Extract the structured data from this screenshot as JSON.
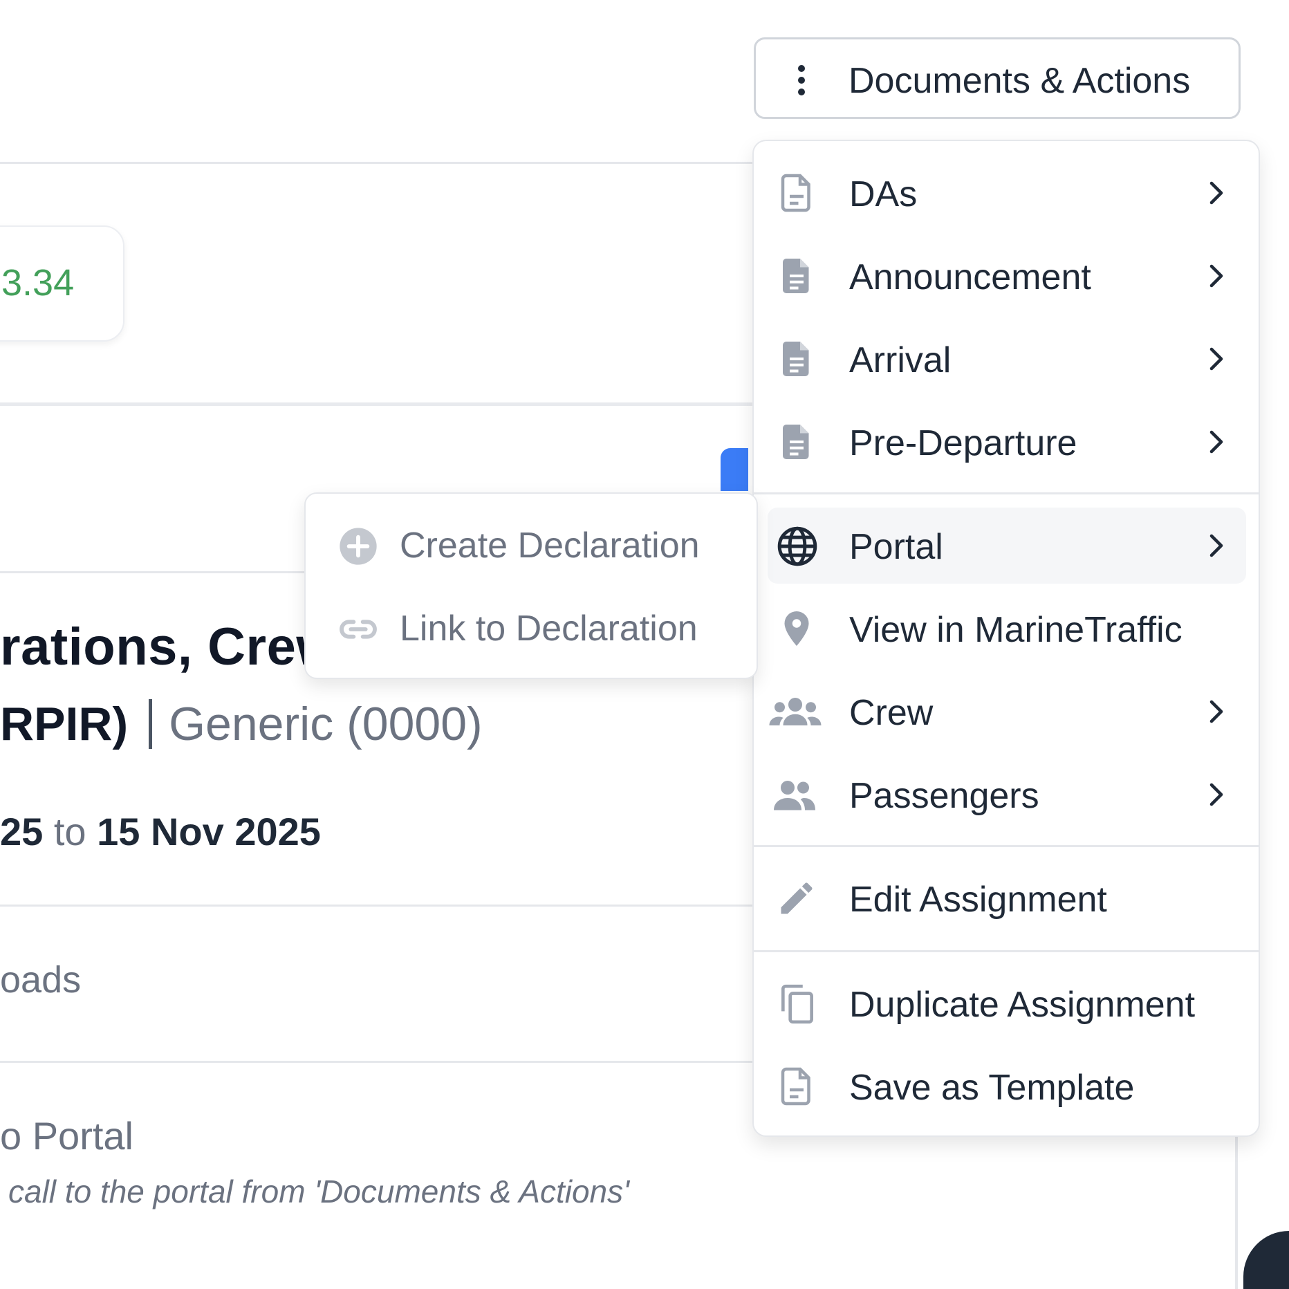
{
  "header": {
    "documents_button_label": "Documents & Actions"
  },
  "background": {
    "amount_value": "3.34",
    "title_fragment": "rations, Crew",
    "subtitle_fragment": "RPIR)",
    "subtitle_generic": "Generic (0000)",
    "dates_start_fragment": "25",
    "dates_to": "to",
    "dates_end": "15 Nov 2025",
    "uploads_fragment": "oads",
    "portal_fragment": "o Portal",
    "portal_hint": "call to the portal from 'Documents & Actions'"
  },
  "menu": {
    "items": [
      {
        "label": "DAs",
        "icon": "document-outline-icon",
        "has_submenu": true
      },
      {
        "label": "Announcement",
        "icon": "document-filled-icon",
        "has_submenu": true
      },
      {
        "label": "Arrival",
        "icon": "document-filled-icon",
        "has_submenu": true
      },
      {
        "label": "Pre-Departure",
        "icon": "document-filled-icon",
        "has_submenu": true
      },
      {
        "label": "Portal",
        "icon": "globe-icon",
        "has_submenu": true,
        "active": true
      },
      {
        "label": "View in MarineTraffic",
        "icon": "map-pin-icon",
        "has_submenu": false
      },
      {
        "label": "Crew",
        "icon": "group-icon",
        "has_submenu": true
      },
      {
        "label": "Passengers",
        "icon": "people-icon",
        "has_submenu": true
      },
      {
        "label": "Edit Assignment",
        "icon": "pencil-icon",
        "has_submenu": false
      },
      {
        "label": "Duplicate Assignment",
        "icon": "copy-icon",
        "has_submenu": false
      },
      {
        "label": "Save as Template",
        "icon": "document-outline-icon",
        "has_submenu": false
      }
    ]
  },
  "submenu": {
    "items": [
      {
        "label": "Create Declaration",
        "icon": "plus-circle-icon"
      },
      {
        "label": "Link to Declaration",
        "icon": "link-icon"
      }
    ]
  },
  "colors": {
    "accent_blue": "#3b7cf6",
    "amount_green": "#43a05a",
    "icon_gray": "#9ca3af",
    "text_dark": "#1f2937",
    "text_muted": "#6b7280"
  }
}
